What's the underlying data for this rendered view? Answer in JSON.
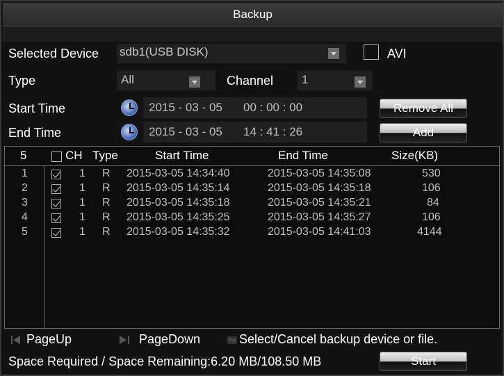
{
  "window": {
    "title": "Backup"
  },
  "form": {
    "selected_device_label": "Selected Device",
    "selected_device_value": "sdb1(USB DISK)",
    "avi_label": "AVI",
    "type_label": "Type",
    "type_value": "All",
    "channel_label": "Channel",
    "channel_value": "1",
    "start_time_label": "Start Time",
    "start_date": "2015 - 03 - 05",
    "start_clock": "00 : 00 : 00",
    "end_time_label": "End Time",
    "end_date": "2015 - 03 - 05",
    "end_clock": "14 : 41 : 26",
    "remove_all_label": "Remove All",
    "add_label": "Add"
  },
  "table": {
    "header": {
      "count": "5",
      "ch": "CH",
      "type": "Type",
      "start": "Start Time",
      "end": "End Time",
      "size": "Size(KB)"
    },
    "rows": [
      {
        "idx": "1",
        "checked": true,
        "ch": "1",
        "type": "R",
        "start": "2015-03-05 14:34:40",
        "end": "2015-03-05 14:35:08",
        "size": "530"
      },
      {
        "idx": "2",
        "checked": true,
        "ch": "1",
        "type": "R",
        "start": "2015-03-05 14:35:14",
        "end": "2015-03-05 14:35:18",
        "size": "106"
      },
      {
        "idx": "3",
        "checked": true,
        "ch": "1",
        "type": "R",
        "start": "2015-03-05 14:35:18",
        "end": "2015-03-05 14:35:21",
        "size": "84"
      },
      {
        "idx": "4",
        "checked": true,
        "ch": "1",
        "type": "R",
        "start": "2015-03-05 14:35:25",
        "end": "2015-03-05 14:35:27",
        "size": "106"
      },
      {
        "idx": "5",
        "checked": true,
        "ch": "1",
        "type": "R",
        "start": "2015-03-05 14:35:32",
        "end": "2015-03-05 14:41:03",
        "size": "4144"
      }
    ]
  },
  "footer": {
    "page_up": "PageUp",
    "page_down": "PageDown",
    "fn_icon": "Fn",
    "hint": "Select/Cancel backup device or file.",
    "space_text": "Space Required / Space Remaining:6.20 MB/108.50 MB",
    "start_label": "Start"
  },
  "icons": {
    "clock": "clock-icon",
    "dropdown": "chevron-down-icon",
    "page_up": "page-up-icon",
    "page_down": "page-down-icon",
    "fn": "fn-key-icon"
  },
  "colors": {
    "background": "#121212",
    "titlebar": "#333333",
    "text": "#ffffff",
    "value_text": "#bfbfbf",
    "clock_blue": "#4c6fb5"
  }
}
